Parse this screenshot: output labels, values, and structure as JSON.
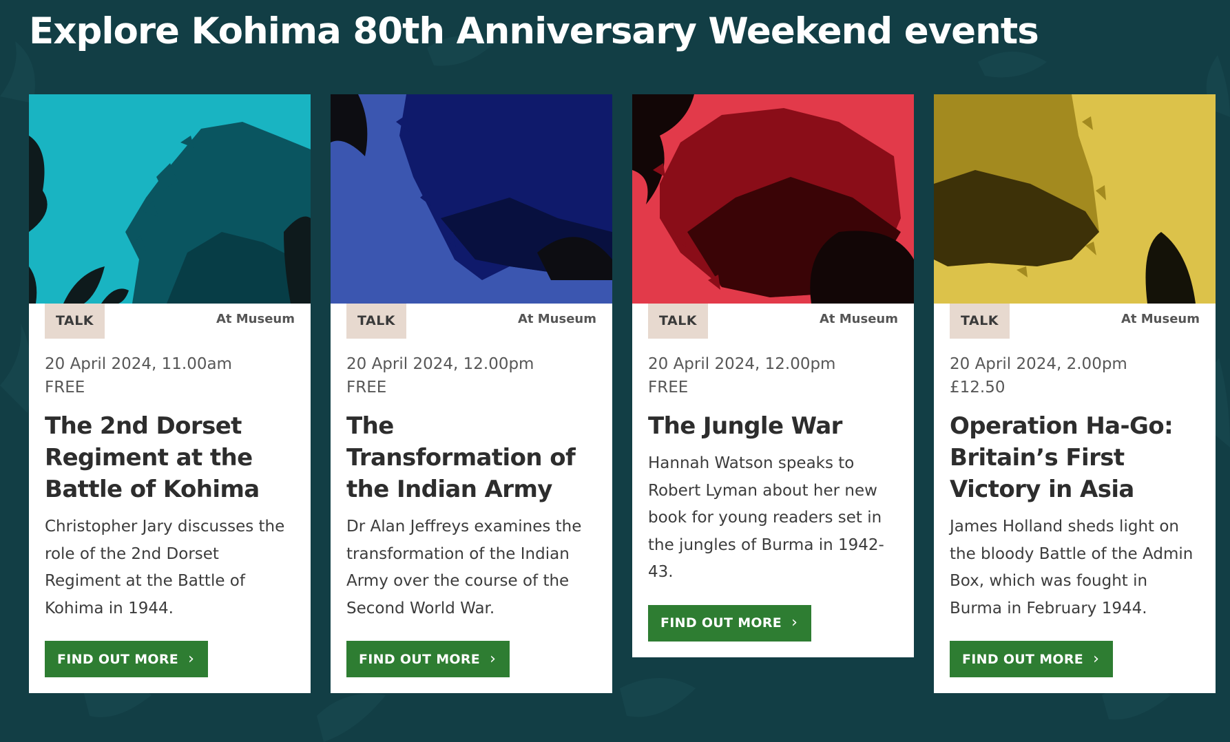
{
  "page": {
    "title": "Explore Kohima 80th Anniversary Weekend events"
  },
  "colors": {
    "background": "#123e45",
    "card_bg": "#ffffff",
    "tag_bg": "#e7d9cf",
    "button_bg": "#2e7d32",
    "button_text": "#ffffff"
  },
  "cards": [
    {
      "image_theme": "teal",
      "image_color": "#19b4c2",
      "tag": "TALK",
      "location": "At Museum",
      "date": "20 April 2024, 11.00am",
      "price": "FREE",
      "title": "The 2nd Dorset Regiment at the Battle of Kohima",
      "description": "Christopher Jary discusses the role of the 2nd Dorset Regiment at the Battle of Kohima in 1944.",
      "button_label": "FIND OUT MORE",
      "button_icon": "chevron-right-icon"
    },
    {
      "image_theme": "blue",
      "image_color": "#3b56b0",
      "tag": "TALK",
      "location": "At Museum",
      "date": "20 April 2024, 12.00pm",
      "price": "FREE",
      "title": "The Transformation of the Indian Army",
      "description": "Dr Alan Jeffreys examines the transformation of the Indian Army over the course of the Second World War.",
      "button_label": "FIND OUT MORE",
      "button_icon": "chevron-right-icon"
    },
    {
      "image_theme": "red",
      "image_color": "#e23a4a",
      "tag": "TALK",
      "location": "At Museum",
      "date": "20 April 2024, 12.00pm",
      "price": "FREE",
      "title": "The Jungle War",
      "description": "Hannah Watson speaks to Robert Lyman about her new book for young readers set in the jungles of Burma in 1942-43.",
      "button_label": "FIND OUT MORE",
      "button_icon": "chevron-right-icon"
    },
    {
      "image_theme": "yellow",
      "image_color": "#dcc24a",
      "tag": "TALK",
      "location": "At Museum",
      "date": "20 April 2024, 2.00pm",
      "price": "£12.50",
      "title": "Operation Ha-Go: Britain’s First Victory in Asia",
      "description": "James Holland sheds light on the bloody Battle of the Admin Box, which was fought in Burma in February 1944.",
      "button_label": "FIND OUT MORE",
      "button_icon": "chevron-right-icon"
    }
  ]
}
